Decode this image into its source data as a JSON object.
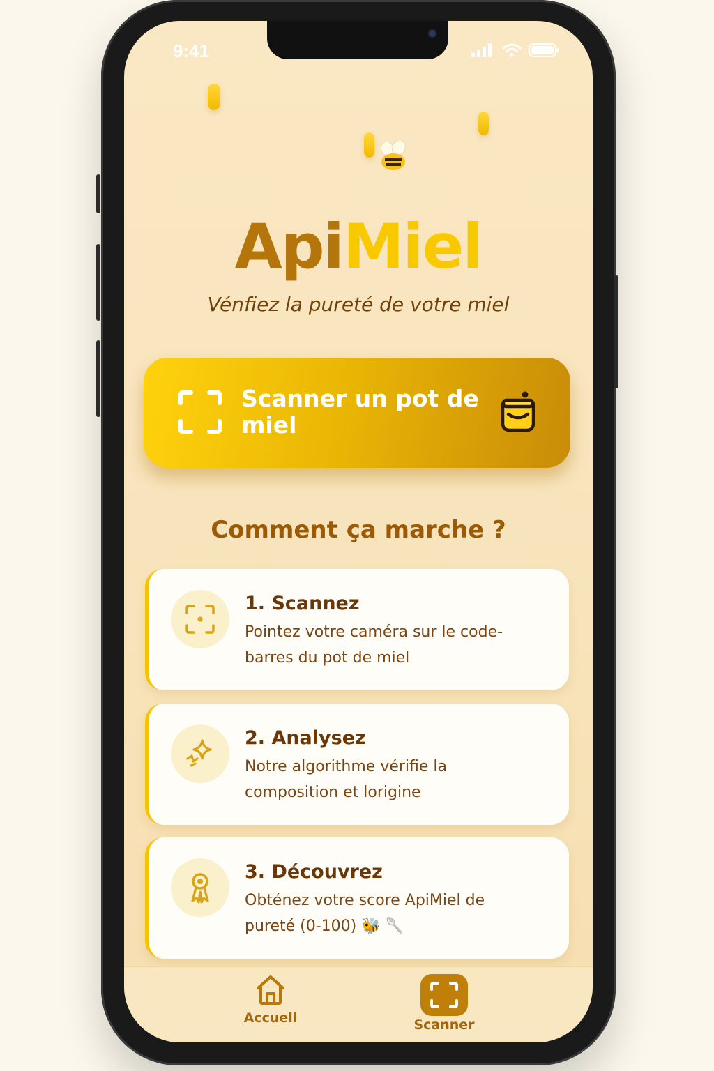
{
  "status_bar": {
    "time": "9:41"
  },
  "app": {
    "logo_part1": "Api",
    "logo_part2": "Miel",
    "tagline": "Vénfiez la pureté de votre miel"
  },
  "scan_button": {
    "label": "Scanner un pot de miel",
    "left_icon": "scan-frame-icon",
    "right_icon": "honey-jar-icon"
  },
  "how_it_works": {
    "title": "Comment ça marche ?",
    "steps": [
      {
        "title": "1. Scannez",
        "description": "Pointez votre caméra sur le code-barres du pot de miel",
        "icon": "scan-focus-icon"
      },
      {
        "title": "2. Analysez",
        "description": "Notre algorithme vérifie la composition et lorigine",
        "icon": "sparkle-icon"
      },
      {
        "title": "3. Découvrez",
        "description": "Obténez votre score ApiMiel de pureté (0-100)",
        "trailing_emoji": "🐝 🥄",
        "icon": "award-ribbon-icon"
      }
    ]
  },
  "tab_bar": {
    "tabs": [
      {
        "label": "Accuell",
        "icon": "home-icon",
        "active": false
      },
      {
        "label": "Scanner",
        "icon": "scan-frame-icon",
        "active": true
      }
    ]
  },
  "colors": {
    "background": "#fae8c4",
    "accent_gold": "#f9c900",
    "brown_dark": "#6a3708",
    "brown_logo": "#b4760b",
    "card_bg": "#fffdf8"
  }
}
